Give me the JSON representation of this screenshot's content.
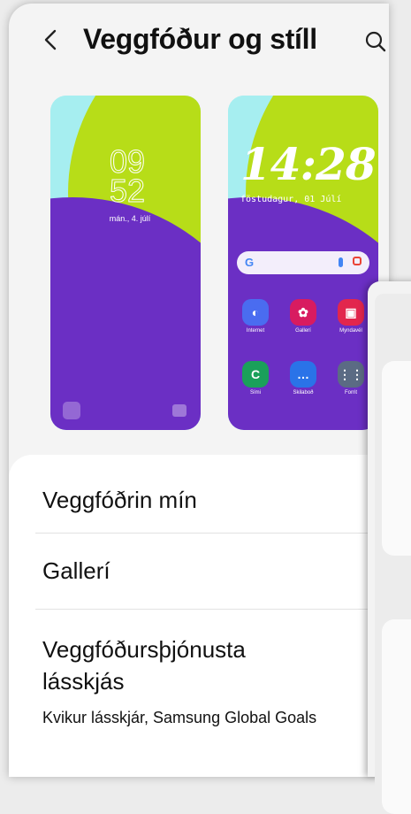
{
  "header": {
    "title": "Veggfóður og stíll"
  },
  "lock_preview": {
    "hour": "09",
    "minute": "52",
    "date": "mán., 4. júlí"
  },
  "home_preview": {
    "time": "14:28",
    "date": "föstudagur, 01 Júlí",
    "apps_row1": [
      {
        "label": "Internet",
        "icon": "internet-icon",
        "color": "#4a6cf0"
      },
      {
        "label": "Gallerí",
        "icon": "gallery-icon",
        "color": "#d81b60"
      },
      {
        "label": "Myndavél",
        "icon": "camera-icon",
        "color": "#e2264d"
      }
    ],
    "apps_row2": [
      {
        "label": "Sími",
        "icon": "phone-icon",
        "color": "#1aa05a"
      },
      {
        "label": "Skilaboð",
        "icon": "messages-icon",
        "color": "#2a73e8"
      },
      {
        "label": "Forrit",
        "icon": "apps-icon",
        "color": "#5b6b84"
      }
    ]
  },
  "menu": {
    "my_wallpapers": "Veggfóðrin mín",
    "gallery": "Gallerí",
    "service_title_line1": "Veggfóðursþjónusta",
    "service_title_line2": "lásskjás",
    "service_subtitle": "Kvikur lásskjár, Samsung Global Goals"
  },
  "colors": {
    "wall_bg": "#a6eef0",
    "wall_purple": "#6b2fc4",
    "wall_green": "#b7dd18"
  }
}
